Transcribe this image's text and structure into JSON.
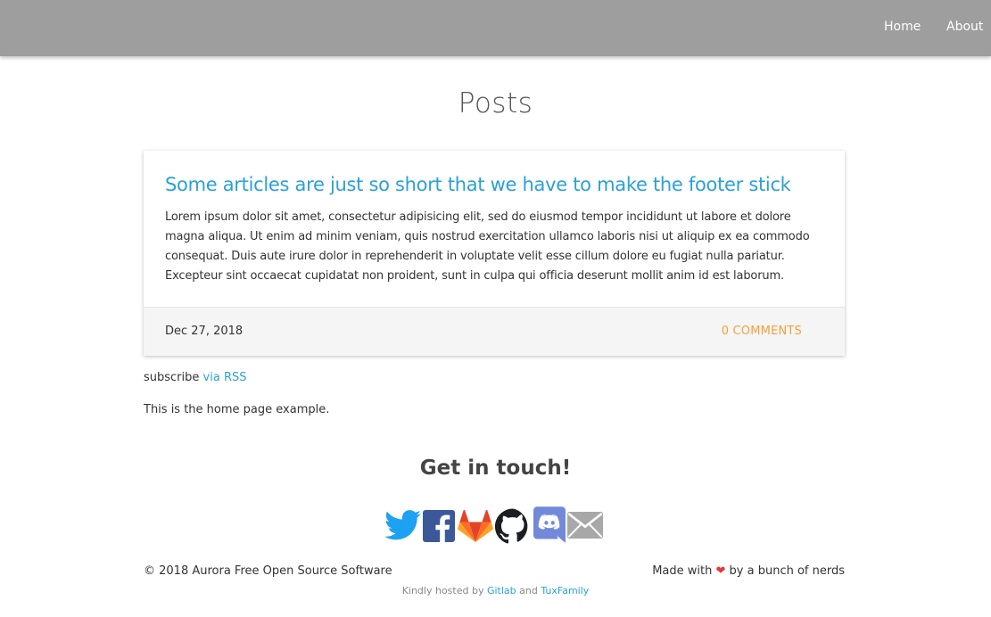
{
  "nav": {
    "home_label": "Home",
    "about_label": "About"
  },
  "page": {
    "title": "Posts"
  },
  "post": {
    "title": "Some articles are just so short that we have to make the footer stick",
    "excerpt": "Lorem ipsum dolor sit amet, consectetur adipisicing elit, sed do eiusmod tempor incididunt ut labore et dolore magna aliqua. Ut enim ad minim veniam, quis nostrud exercitation ullamco laboris nisi ut aliquip ex ea commodo consequat. Duis aute irure dolor in reprehenderit in voluptate velit esse cillum dolore eu fugiat nulla pariatur. Excepteur sint occaecat cupidatat non proident, sunt in culpa qui officia deserunt mollit anim id est laborum.",
    "date": "Dec 27, 2018",
    "comments": "0 comments"
  },
  "subscribe": {
    "prefix": "subscribe",
    "link_label": "via RSS"
  },
  "home_note": "This is the home page example.",
  "contact": {
    "title": "Get in touch!",
    "icons": [
      "twitter-icon",
      "facebook-icon",
      "gitlab-icon",
      "github-icon",
      "discord-icon",
      "email-icon"
    ]
  },
  "footer": {
    "copyright": "© 2018 Aurora Free Open Source Software",
    "made_with_prefix": "Made with",
    "heart": "❤",
    "made_with_suffix": "by a bunch of nerds",
    "hosted_prefix": "Kindly hosted by",
    "hosted_link_1": "Gitlab",
    "hosted_and": "and",
    "hosted_link_2": "TuxFamily"
  },
  "colors": {
    "navbar": "#9e9e9e",
    "link": "#2aa1d7",
    "comments": "#f0a33a",
    "heart": "#e53935",
    "twitter": "#1da1f2",
    "facebook": "#3b5998",
    "gitlab": "#e24329",
    "github": "#1b1f23",
    "discord": "#7289da",
    "email": "#a8a8a8"
  }
}
